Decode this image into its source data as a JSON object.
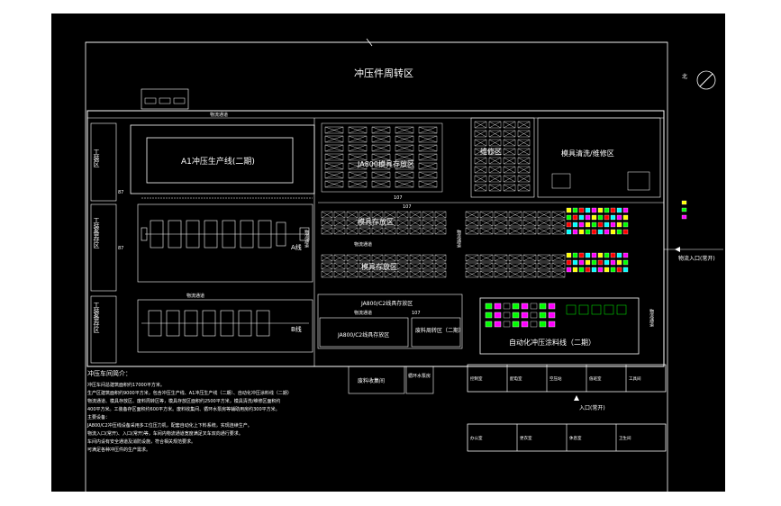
{
  "title": "冲压件周转区",
  "compass": {
    "label": "北"
  },
  "zones": {
    "a1_line": "A1冲压生产线(二期)",
    "a_line": "A线",
    "b_line": "B线",
    "mold_store_top": "JA800模具存放区",
    "mold_store_mid": "模具存放区",
    "mold_store_low": "模具存放区",
    "mold_repair": "模具清洗/维修区",
    "repair_zone": "维修区",
    "ja_zone": "JA800/C2线具存放区",
    "ja_c2": "JA800/C2线具存放区",
    "waste_zone": "废料周转区（二期）",
    "auto_zone": "自动化冲压涂料线（二期）",
    "press_zone": "废料收集间",
    "pump_room": "循环水泵房",
    "tool_zone_1": "工装区",
    "tool_zone_2": "工装备存区",
    "tool_zone_3": "工装备存区",
    "channel": "物流通道",
    "channel_v": "物流通道",
    "entry_right": "物流入口(常开)",
    "entry_bottom": "入口(常开)"
  },
  "dims": {
    "d1": "87",
    "d2": "87",
    "d3": "107",
    "d4": "107",
    "d5": "107"
  },
  "notes": {
    "heading": "冲压车间简介：",
    "lines": [
      "冲压车间总建筑面积约17000平方米。",
      "生产区建筑面积约9000平方米，包含冲压生产线、A1冲压生产线（二期）、自动化冲压涂料线（二期）",
      "物流通道、模具存放区、废料周转区等，模具存放区面积约2500平方米，模具清洗/维修区面积约",
      "400平方米。工装备存区面积约600平方米。废料收集间、循环水泵房等辅助用房约300平方米。",
      "主要设备：",
      "JA800/C2冲压线设备采用多工位压力机，配套自动化上下料系统，实现连续生产。",
      "物流入口(常开)、入口(常开)等，车间内物流通道宽度满足叉车双向通行要求。",
      "车间内设有安全通道及消防设施，符合相关规范要求。",
      "可满足各种冲压件的生产需求。"
    ]
  },
  "bottom_labels": [
    "控制室",
    "配电室",
    "空压站",
    "值班室",
    "工具间",
    "办公室",
    "更衣室",
    "休息室",
    "卫生间"
  ]
}
